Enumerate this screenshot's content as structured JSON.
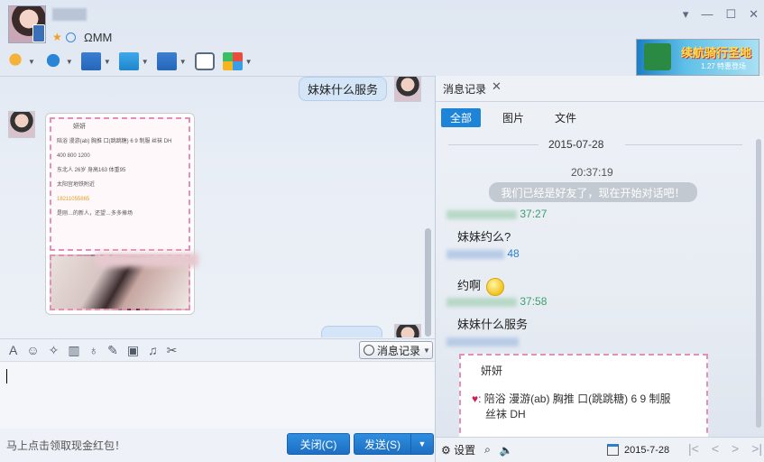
{
  "window": {
    "signature": "ΩMM",
    "controls": [
      "▾",
      "—",
      "☐",
      "✕"
    ]
  },
  "ad": {
    "text": "续航骑行圣地",
    "sub": "1.27 特惠登场"
  },
  "chat": {
    "sent_1": "妹妹什么服务",
    "card": {
      "name": "妍妍",
      "line1": "陪浴 漫游(ab) 胸推 口(跳跳糖) 6 9 制服 丝袜 DH",
      "line2": "400 800 1200",
      "line3": "东北人 26岁 身高163 体重95",
      "line4": "太阳宫地铁附近",
      "phone": "18211055865",
      "line5": "是刚…的新人，还望…多多捧场"
    }
  },
  "input": {
    "message_record_label": "消息记录",
    "promo": "马上点击领取现金红包！",
    "close_label": "关闭(C)",
    "send_label": "发送(S)"
  },
  "history": {
    "tab_label": "消息记录",
    "filters": [
      "全部",
      "图片",
      "文件"
    ],
    "date": "2015-07-28",
    "time": "20:37:19",
    "system_message": "我们已经是好友了，现在开始对话吧！",
    "entries": [
      {
        "time": "37:27",
        "text": "妹妹约么?"
      },
      {
        "time": "48",
        "text": "约啊"
      },
      {
        "time": "37:58",
        "text": "妹妹什么服务"
      }
    ],
    "card_name": "妍妍",
    "card_line1": "陪浴 漫游(ab) 胸推 口(跳跳糖) 6 9 制服",
    "card_line2": "丝袜 DH",
    "settings_label": "设置",
    "date_picker": "2015-7-28"
  }
}
